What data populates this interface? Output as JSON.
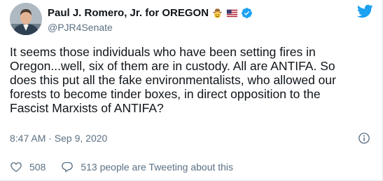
{
  "author": {
    "display_name": "Paul J. Romero, Jr. for OREGON",
    "handle": "@PJR4Senate",
    "badges": [
      "cowboy-face-emoji",
      "us-flag-emoji",
      "verified-icon"
    ]
  },
  "tweet": {
    "text": "It seems those individuals who have been setting fires in\nOregon...well, six of them are in custody.  All are ANTIFA.  So\ndoes this put all the fake environmentalists, who allowed our\nforests to become tinder boxes, in direct opposition to the\nFascist Marxists of ANTIFA?",
    "timestamp": "8:47 AM · Sep 9, 2020"
  },
  "actions": {
    "like_count": "508",
    "reply_text": "513 people are Tweeting about this"
  },
  "colors": {
    "twitter_blue": "#1da1f2",
    "secondary_text": "#5b7083",
    "primary_text": "#0f1419"
  },
  "icons": [
    "twitter-logo-icon",
    "info-icon",
    "heart-icon",
    "reply-bubble-icon"
  ]
}
